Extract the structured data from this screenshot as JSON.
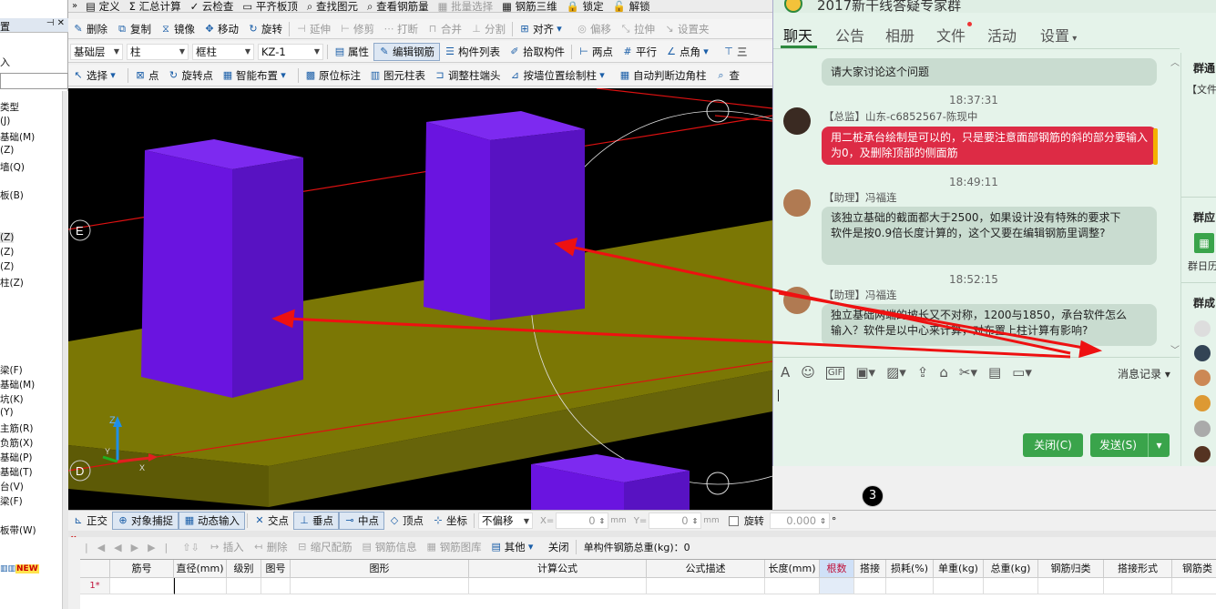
{
  "menu": {
    "items": [
      "定义",
      "汇总计算",
      "云检查",
      "平齐板顶",
      "查找图元",
      "查看钢筋量",
      "批量选择",
      "钢筋三维",
      "锁定",
      "解锁"
    ]
  },
  "toolbar2": {
    "items": [
      "删除",
      "复制",
      "镜像",
      "移动",
      "旋转",
      "延伸",
      "修剪",
      "打断",
      "合并",
      "分割",
      "对齐",
      "偏移",
      "拉伸",
      "设置夹"
    ]
  },
  "toolbar3": {
    "layer": "基础层",
    "type": "柱",
    "subtype": "框柱",
    "component": "KZ-1",
    "buttons": [
      "属性",
      "编辑钢筋",
      "构件列表",
      "拾取构件",
      "两点",
      "平行",
      "点角",
      "三"
    ]
  },
  "toolbar4": {
    "buttons": [
      "选择",
      "点",
      "旋转点",
      "智能布置",
      "原位标注",
      "图元柱表",
      "调整柱端头",
      "按墙位置绘制柱",
      "自动判断边角柱",
      "查"
    ]
  },
  "left_panel": {
    "header": "置",
    "sub": "入",
    "items": [
      "类型",
      "(J)",
      "基础(M)",
      "(Z)",
      "墙(Q)",
      "板(B)",
      "(Z)",
      "(Z)",
      "(Z)",
      "柱(Z)",
      "梁(F)",
      "基础(M)",
      "坑(K)",
      "(Y)",
      "主筋(R)",
      "负筋(X)",
      "基础(P)",
      "基础(T)",
      "台(V)",
      "梁(F)",
      "板带(W)"
    ],
    "new_badge": "NEW"
  },
  "viewport": {
    "axis_labels": [
      "E",
      "D",
      "3"
    ],
    "axis_z": "Z",
    "axis_x": "X",
    "axis_y": "Y"
  },
  "snapbar": {
    "items": [
      "正交",
      "对象捕捉",
      "动态输入",
      "交点",
      "垂点",
      "中点",
      "顶点",
      "坐标"
    ],
    "offset_mode": "不偏移",
    "x_label": "X=",
    "x_value": "0",
    "y_label": "Y=",
    "y_value": "0",
    "unit": "mm",
    "rotate_label": "旋转",
    "rotate_value": "0.000",
    "degree": "°"
  },
  "gridbar": {
    "items": [
      "插入",
      "删除",
      "缩尺配筋",
      "钢筋信息",
      "钢筋图库",
      "其他",
      "关闭"
    ],
    "total_label": "单构件钢筋总重(kg)：0"
  },
  "grid": {
    "columns": [
      "筋号",
      "直径(mm)",
      "级别",
      "图号",
      "图形",
      "计算公式",
      "公式描述",
      "长度(mm)",
      "根数",
      "搭接",
      "损耗(%)",
      "单重(kg)",
      "总重(kg)",
      "钢筋归类",
      "搭接形式",
      "钢筋类"
    ],
    "row_label": "1*"
  },
  "chat": {
    "title": "2017新干线答疑专家群",
    "tabs": [
      "聊天",
      "公告",
      "相册",
      "文件",
      "活动",
      "设置"
    ],
    "messages": [
      {
        "text": "请大家讨论这个问题"
      },
      {
        "time": "18:37:31",
        "sender": "【总监】山东-c6852567-陈现中",
        "text": "用二桩承台绘制是可以的，只是要注意面部钢筋的斜的部分要输入为0，及删除顶部的侧面筋",
        "highlight": true
      },
      {
        "time": "18:49:11",
        "sender": "【助理】冯福连",
        "text1": "该独立基础的截面都大于2500，如果设计没有特殊的要求下",
        "text2": "软件是按0.9倍长度计算的，这个又要在编辑钢筋里调整?"
      },
      {
        "time": "18:52:15",
        "sender": "【助理】冯福连",
        "text1": "独立基础两端的坡长又不对称，1200与1850，承台软件怎么",
        "text2": "输入？软件是以中心来计算，对布置上柱计算有影响?"
      }
    ],
    "history_label": "消息记录",
    "close_label": "关闭(C)",
    "send_label": "发送(S)"
  },
  "right_side": {
    "sections": [
      "群通",
      "【文件",
      "群应",
      "群日历",
      "群成"
    ]
  },
  "colors": {
    "column_purple": "#6a14e0",
    "slab_olive": "#7e7a05",
    "arrow_red": "#ee1111",
    "chat_bg": "#e5f3ea",
    "highlight_red": "#dd2b45",
    "send_green": "#3aa44b"
  }
}
